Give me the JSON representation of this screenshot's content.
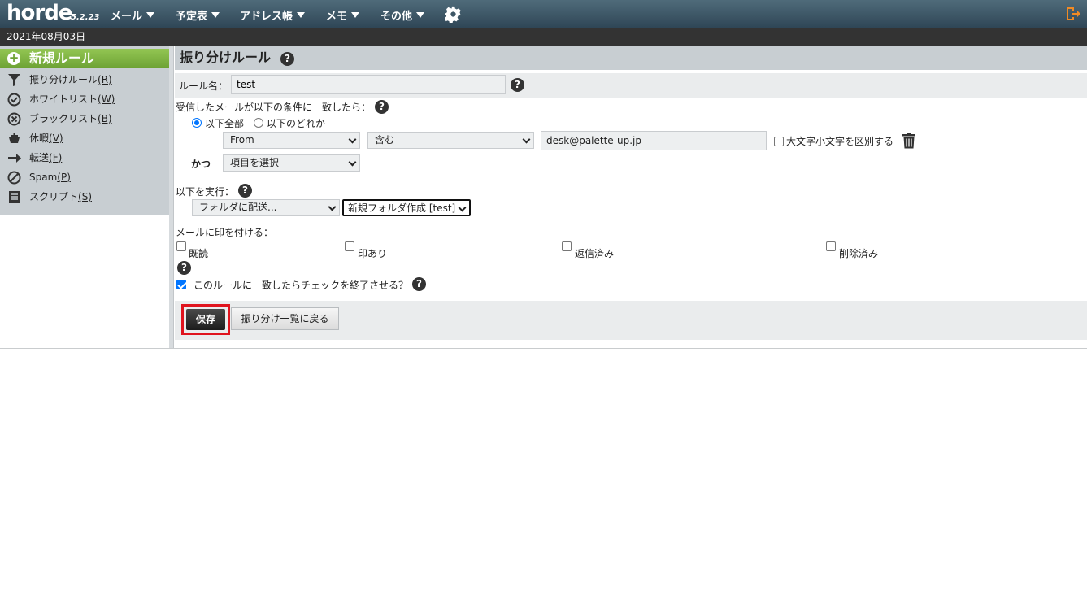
{
  "topbar": {
    "logo": "horde",
    "version": "5.2.23",
    "menus": [
      "メール",
      "予定表",
      "アドレス帳",
      "メモ",
      "その他"
    ]
  },
  "datebar": {
    "date": "2021年08月03日"
  },
  "sidebar": {
    "new_rule": "新規ルール",
    "items": [
      {
        "label": "振り分けルール",
        "key": "(R)"
      },
      {
        "label": "ホワイトリスト",
        "key": "(W)"
      },
      {
        "label": "ブラックリスト",
        "key": "(B)"
      },
      {
        "label": "休暇",
        "key": "(V)"
      },
      {
        "label": "転送",
        "key": "(F)"
      },
      {
        "label": "Spam",
        "key": "(P)"
      },
      {
        "label": "スクリプト",
        "key": "(S)"
      }
    ]
  },
  "main": {
    "title": "振り分けルール",
    "rule_name_label": "ルール名：",
    "rule_name_value": "test",
    "conditions_label": "受信したメールが以下の条件に一致したら：",
    "match_all": "以下全部",
    "match_any": "以下のどれか",
    "field_select": "From",
    "op_select": "含む",
    "value_input": "desk@palette-up.jp",
    "case_sensitive": "大文字小文字を区別する",
    "and_label": "かつ",
    "item_select": "項目を選択",
    "action_label": "以下を実行：",
    "action_select": "フォルダに配送...",
    "folder_select": "新規フォルダ作成 [test]",
    "flag_label": "メールに印を付ける：",
    "flags": [
      "既読",
      "印あり",
      "返信済み",
      "削除済み"
    ],
    "stop_label": "このルールに一致したらチェックを終了させる？",
    "save_button": "保存",
    "back_button": "振り分け一覧に戻る"
  },
  "help_glyph": "?",
  "colors": {
    "accent_green": "#6da234",
    "highlight_red": "#e0141e",
    "check_blue": "#0075ff"
  }
}
